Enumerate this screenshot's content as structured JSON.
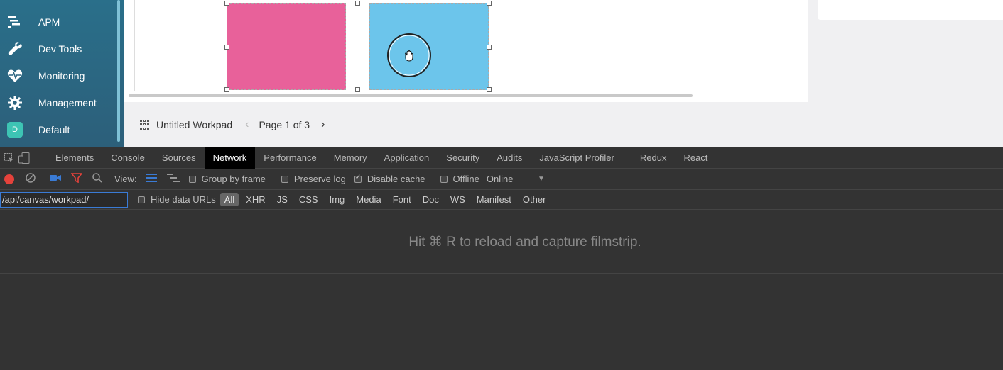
{
  "sidebar": {
    "items": [
      {
        "label": "APM",
        "icon": "apm-icon"
      },
      {
        "label": "Dev Tools",
        "icon": "wrench-icon"
      },
      {
        "label": "Monitoring",
        "icon": "heartbeat-icon"
      },
      {
        "label": "Management",
        "icon": "gear-icon"
      },
      {
        "label": "Default",
        "icon": "space-avatar",
        "badge": "D"
      }
    ]
  },
  "canvas": {
    "shapes": [
      {
        "name": "pink-rectangle",
        "color": "#e8619a"
      },
      {
        "name": "blue-rectangle",
        "color": "#6cc5eb"
      }
    ]
  },
  "footer": {
    "workpad_title": "Untitled Workpad",
    "prev": "‹",
    "page_label": "Page 1 of 3",
    "next": "›"
  },
  "devtools": {
    "tabs": [
      "Elements",
      "Console",
      "Sources",
      "Network",
      "Performance",
      "Memory",
      "Application",
      "Security",
      "Audits",
      "JavaScript Profiler",
      "Redux",
      "React"
    ],
    "active_tab": "Network",
    "toolbar": {
      "view_label": "View:",
      "group_by_frame": "Group by frame",
      "preserve_log": "Preserve log",
      "disable_cache": "Disable cache",
      "offline": "Offline",
      "throttle": "Online"
    },
    "filter": {
      "value": "/api/canvas/workpad/",
      "hide_data_urls": "Hide data URLs",
      "types": [
        "All",
        "XHR",
        "JS",
        "CSS",
        "Img",
        "Media",
        "Font",
        "Doc",
        "WS",
        "Manifest",
        "Other"
      ],
      "active_type": "All"
    },
    "message": "Hit ⌘ R to reload and capture filmstrip."
  }
}
